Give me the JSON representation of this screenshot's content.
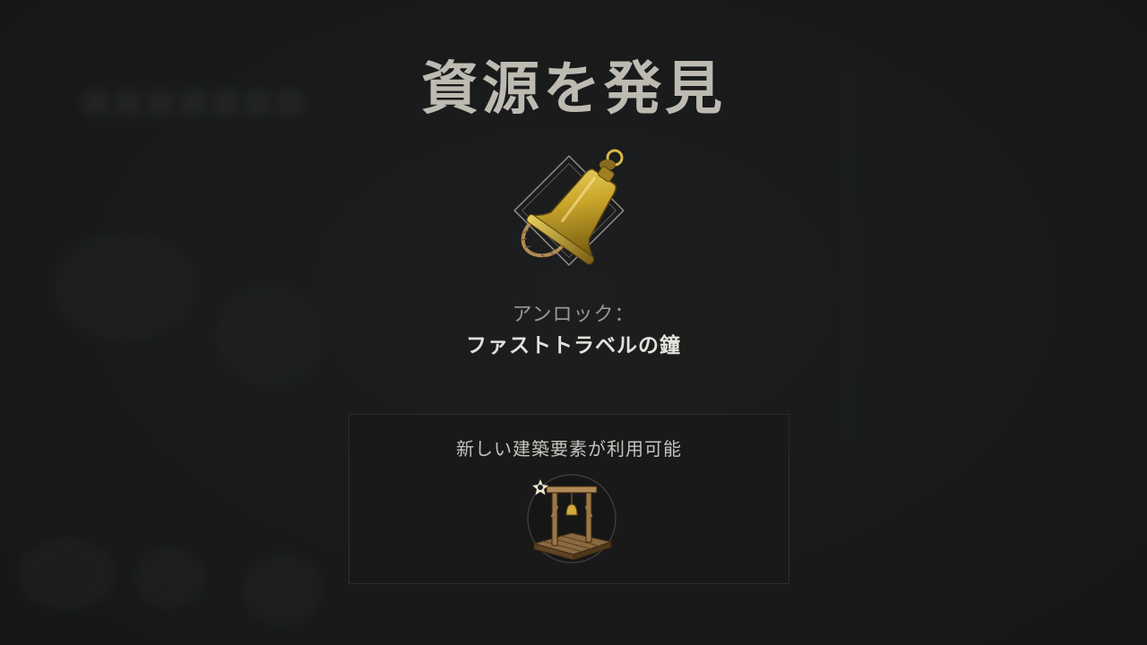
{
  "dialog": {
    "title": "資源を発見",
    "unlock_label": "アンロック：",
    "unlock_item": "ファストトラベルの鐘",
    "unlocked_icon": "bell-icon"
  },
  "build_panel": {
    "caption": "新しい建築要素が利用可能",
    "item_icon": "bell-frame-structure-icon"
  },
  "colors": {
    "title": "#bdbab2",
    "gold": "#c9a52a",
    "background": "#1c1d1e"
  }
}
